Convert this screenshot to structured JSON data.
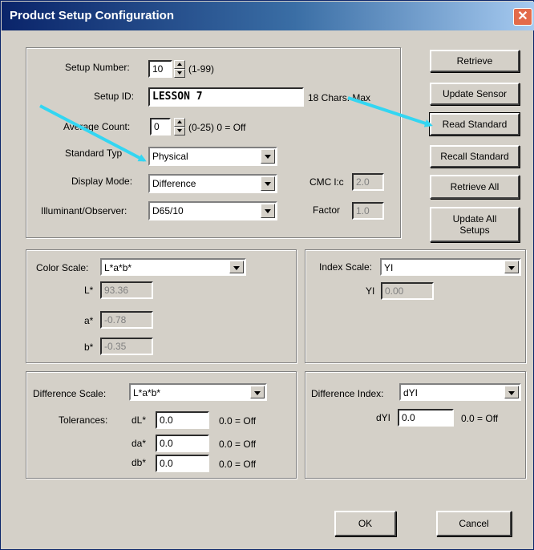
{
  "window": {
    "title": "Product Setup Configuration",
    "close_symbol": "✕"
  },
  "setup": {
    "setup_number_label": "Setup Number:",
    "setup_number_value": "10",
    "setup_number_range": "(1-99)",
    "setup_id_label": "Setup ID:",
    "setup_id_value": "LESSON 7",
    "setup_id_hint": "18 Chars. Max",
    "average_count_label": "Average Count:",
    "average_count_value": "0",
    "average_count_hint": "(0-25) 0 = Off",
    "standard_type_label": "Standard Typ",
    "standard_type_value": "Physical",
    "display_mode_label": "Display Mode:",
    "display_mode_value": "Difference",
    "illuminant_label": "Illuminant/Observer:",
    "illuminant_value": "D65/10",
    "cmc_label": "CMC l:c",
    "cmc_value": "2.0",
    "factor_label": "Factor",
    "factor_value": "1.0"
  },
  "buttons": {
    "retrieve": "Retrieve",
    "update_sensor": "Update Sensor",
    "read_standard": "Read Standard",
    "recall_standard": "Recall Standard",
    "retrieve_all": "Retrieve All",
    "update_all_line1": "Update All",
    "update_all_line2": "Setups",
    "ok": "OK",
    "cancel": "Cancel"
  },
  "color_scale": {
    "label": "Color Scale:",
    "value": "L*a*b*",
    "rows": [
      {
        "label": "L*",
        "value": "93.36"
      },
      {
        "label": "a*",
        "value": "-0.78"
      },
      {
        "label": "b*",
        "value": "-0.35"
      }
    ]
  },
  "index_scale": {
    "label": "Index Scale:",
    "value": "YI",
    "yi_label": "YI",
    "yi_value": "0.00"
  },
  "difference_scale": {
    "label": "Difference Scale:",
    "value": "L*a*b*",
    "tolerances_label": "Tolerances:",
    "rows": [
      {
        "label": "dL*",
        "value": "0.0",
        "hint": "0.0 = Off"
      },
      {
        "label": "da*",
        "value": "0.0",
        "hint": "0.0 = Off"
      },
      {
        "label": "db*",
        "value": "0.0",
        "hint": "0.0 = Off"
      }
    ]
  },
  "difference_index": {
    "label": "Difference Index:",
    "value": "dYI",
    "dyi_label": "dYI",
    "dyi_value": "0.0",
    "dyi_hint": "0.0 = Off"
  },
  "colors": {
    "annotation_arrow": "#33d6f2",
    "title_bar": "#0a246a",
    "dialog_bg": "#d4d0c8"
  }
}
